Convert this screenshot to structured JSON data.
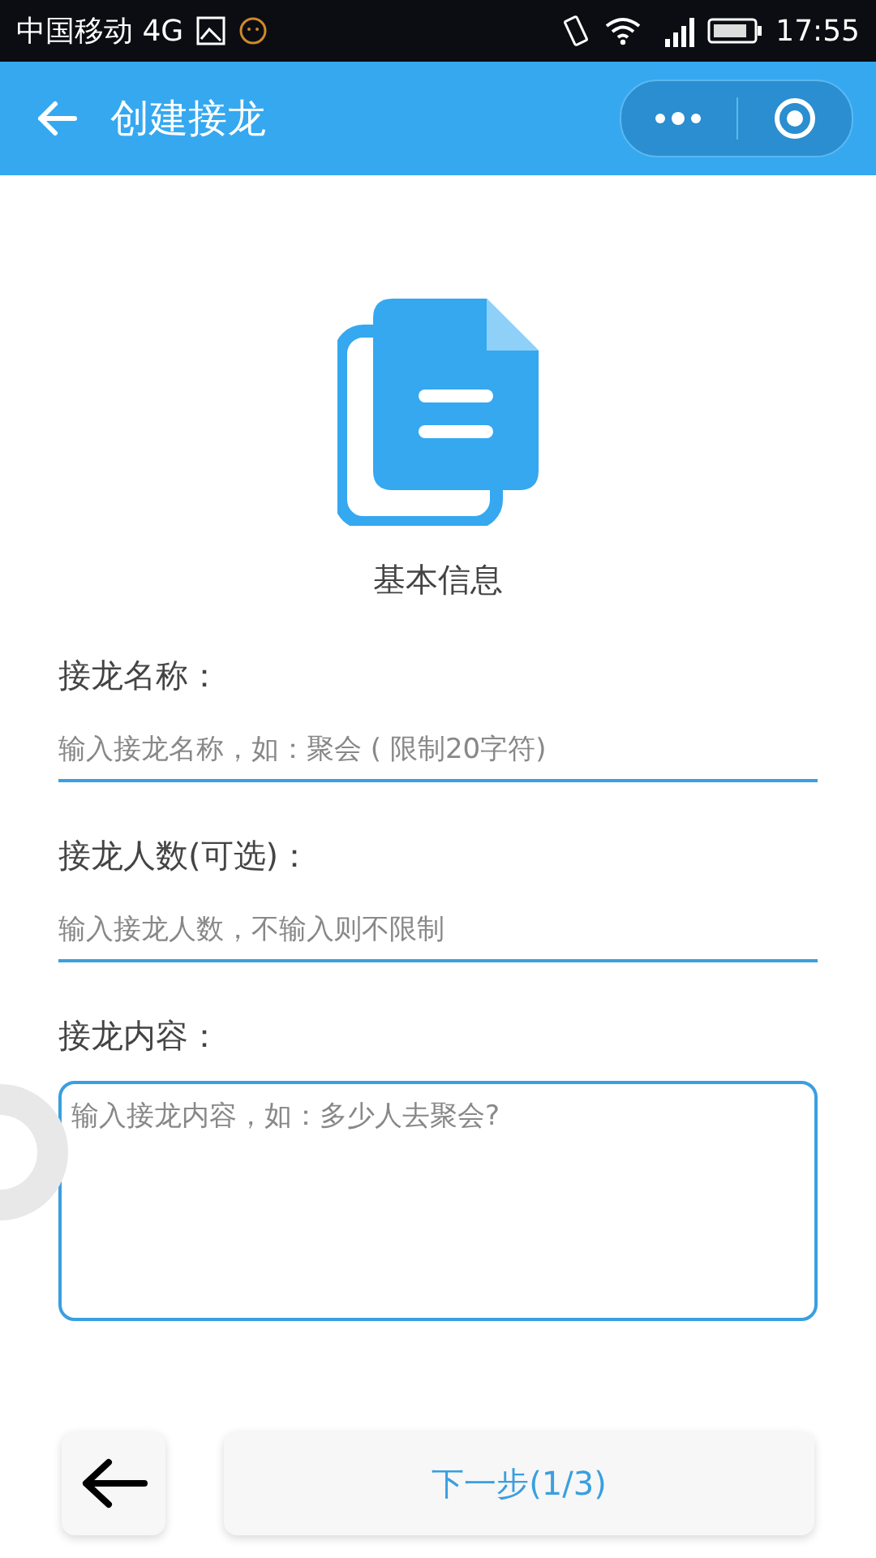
{
  "status_bar": {
    "carrier": "中国移动 4G",
    "time": "17:55"
  },
  "nav_bar": {
    "title": "创建接龙"
  },
  "header": {
    "label": "基本信息"
  },
  "fields": [
    {
      "kind": "line",
      "label": "接龙名称：",
      "placeholder": "输入接龙名称，如：聚会 ( 限制20字符)"
    },
    {
      "kind": "line",
      "label": "接龙人数(可选)：",
      "placeholder": "输入接龙人数，不输入则不限制"
    },
    {
      "kind": "area",
      "label": "接龙内容：",
      "placeholder": "输入接龙内容，如：多少人去聚会?"
    }
  ],
  "footer": {
    "next_label": "下一步(1/3)"
  }
}
